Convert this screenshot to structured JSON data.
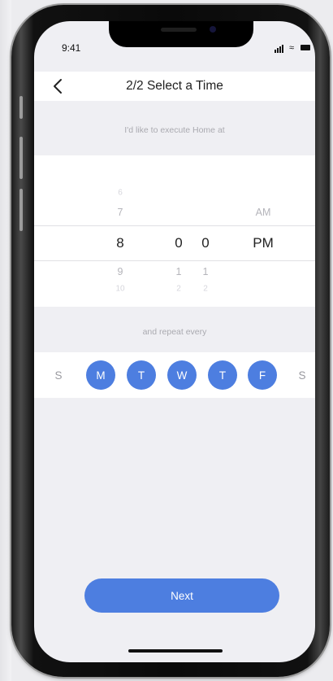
{
  "status_bar": {
    "time": "9:41"
  },
  "nav": {
    "title": "2/2 Select a Time"
  },
  "prompt": {
    "text": "I'd like to execute Home at"
  },
  "picker": {
    "hour": {
      "ghost_above": "6",
      "above": "7",
      "selected": "8",
      "below": "9",
      "ghost_below": "10"
    },
    "minute_tens": {
      "selected": "0",
      "below": "1",
      "ghost_below": "2"
    },
    "minute_ones": {
      "selected": "0",
      "below": "1",
      "ghost_below": "2"
    },
    "ampm": {
      "above": "AM",
      "selected": "PM"
    }
  },
  "repeat": {
    "text": "and repeat every"
  },
  "days": [
    {
      "label": "S",
      "selected": false
    },
    {
      "label": "M",
      "selected": true
    },
    {
      "label": "T",
      "selected": true
    },
    {
      "label": "W",
      "selected": true
    },
    {
      "label": "T",
      "selected": true
    },
    {
      "label": "F",
      "selected": true
    },
    {
      "label": "S",
      "selected": false
    }
  ],
  "next_button": {
    "label": "Next"
  },
  "colors": {
    "accent": "#4d7ee0",
    "screen_bg": "#efeff3",
    "text_primary": "#222222",
    "text_muted": "#aaaab0"
  },
  "icons": {
    "back": "chevron-left-icon",
    "signal": "signal-icon",
    "wifi": "wifi-icon",
    "battery": "battery-icon"
  }
}
